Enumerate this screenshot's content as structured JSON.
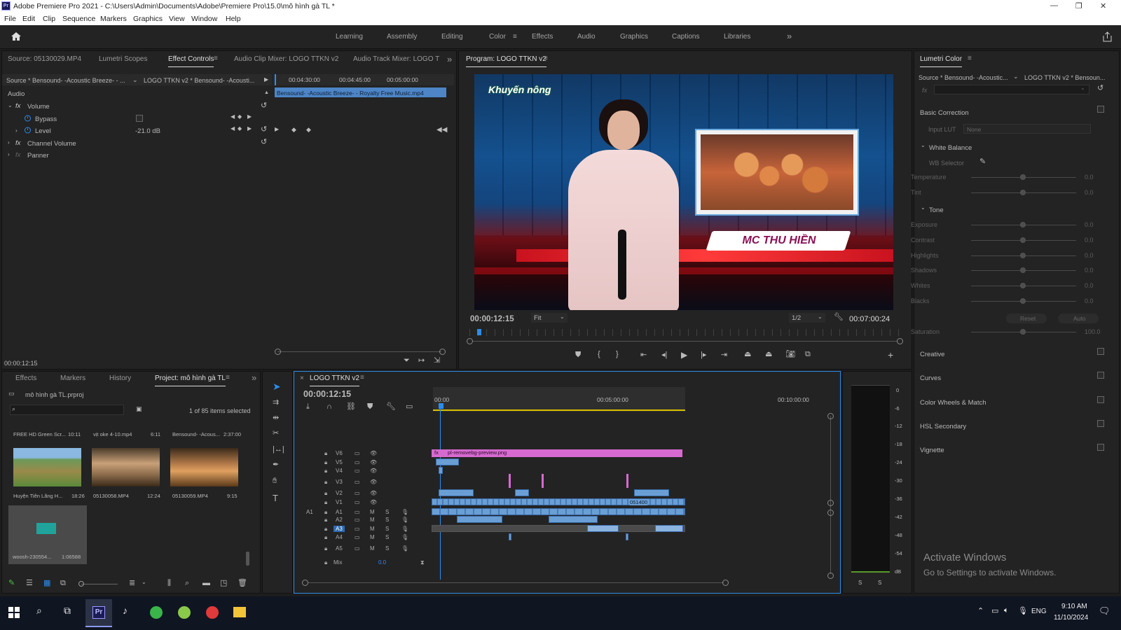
{
  "titlebar": {
    "title": "Adobe Premiere Pro 2021 - C:\\Users\\Admin\\Documents\\Adobe\\Premiere Pro\\15.0\\mô hình gà TL *",
    "app_icon": "Pr"
  },
  "menu": [
    "File",
    "Edit",
    "Clip",
    "Sequence",
    "Markers",
    "Graphics",
    "View",
    "Window",
    "Help"
  ],
  "workspaces": {
    "items": [
      "Learning",
      "Assembly",
      "Editing",
      "Color",
      "Effects",
      "Audio",
      "Graphics",
      "Captions",
      "Libraries"
    ],
    "active": "Color",
    "more": "»"
  },
  "source_panel": {
    "tabs": [
      "Source: 05130029.MP4",
      "Lumetri Scopes",
      "Effect Controls",
      "Audio Clip Mixer: LOGO TTKN v2",
      "Audio Track Mixer: LOGO T"
    ],
    "active_tab": "Effect Controls",
    "source_label": "Source * Bensound- -Acoustic Breeze- - ...",
    "seq_label": "LOGO TTKN v2 * Bensound- -Acousti...",
    "section": "Audio",
    "volume": "Volume",
    "bypass": "Bypass",
    "level": "Level",
    "level_value": "-21.0 dB",
    "channel_volume": "Channel Volume",
    "panner": "Panner",
    "ruler": [
      "00:04:30:00",
      "00:04:45:00",
      "00:05:00:00"
    ],
    "clip_name": "Bensound- -Acoustic Breeze- - Royalty Free Music.mp4",
    "timecode": "00:00:12:15"
  },
  "program": {
    "title": "Program: LOGO TTKN v2",
    "timecode": "00:00:12:15",
    "fit": "Fit",
    "resolution": "1/2",
    "duration": "00:07:00:24",
    "video": {
      "logo_text": "Khuyến nông",
      "name_tag": "MC THU HIỀN"
    }
  },
  "lumetri": {
    "title": "Lumetri Color",
    "source_label": "Source * Bensound- -Acoustic...",
    "seq_label": "LOGO TTKN v2 * Bensoun...",
    "basic_correction": "Basic Correction",
    "input_lut": "Input LUT",
    "input_lut_value": "None",
    "white_balance": "White Balance",
    "wb_selector": "WB Selector",
    "sliders_wb": [
      {
        "name": "Temperature",
        "value": "0.0"
      },
      {
        "name": "Tint",
        "value": "0.0"
      }
    ],
    "tone": "Tone",
    "sliders_tone": [
      {
        "name": "Exposure",
        "value": "0.0"
      },
      {
        "name": "Contrast",
        "value": "0.0"
      },
      {
        "name": "Highlights",
        "value": "0.0"
      },
      {
        "name": "Shadows",
        "value": "0.0"
      },
      {
        "name": "Whites",
        "value": "0.0"
      },
      {
        "name": "Blacks",
        "value": "0.0"
      }
    ],
    "reset": "Reset",
    "auto": "Auto",
    "saturation": {
      "name": "Saturation",
      "value": "100.0"
    },
    "sections": [
      "Creative",
      "Curves",
      "Color Wheels & Match",
      "HSL Secondary",
      "Vignette"
    ]
  },
  "project": {
    "tabs": [
      "Effects",
      "Markers",
      "History",
      "Project: mô hình gà TL"
    ],
    "active_tab": "Project: mô hình gà TL",
    "project_file": "mô hình gà TL.prproj",
    "selected_count": "1 of 85 items selected",
    "items": [
      {
        "name": "FREE HD Green Scr...",
        "duration": "10:11"
      },
      {
        "name": "vịt oke 4-10.mp4",
        "duration": "6:11"
      },
      {
        "name": "Bensound- -Acous...",
        "duration": "2:37:00"
      },
      {
        "name": "Huyện Tiên Lãng H...",
        "duration": "18:26"
      },
      {
        "name": "05130058.MP4",
        "duration": "12:24"
      },
      {
        "name": "05130059.MP4",
        "duration": "9:15"
      },
      {
        "name": "woosh-230554...",
        "duration": "1:06588"
      }
    ]
  },
  "timeline": {
    "title": "LOGO TTKN v2",
    "timecode": "00:00:12:15",
    "ruler": [
      "00:00",
      "00:05:00:00",
      "00:10:00:00"
    ],
    "video_tracks": [
      "V6",
      "V5",
      "V4",
      "V3",
      "V2",
      "V1"
    ],
    "audio_tracks": [
      "A1",
      "A2",
      "A3",
      "A4",
      "A5"
    ],
    "src_patch": "A1",
    "mix": "Mix",
    "mix_value": "0.0",
    "clips": {
      "v6": "pl-removebg-preview.png",
      "v1": "051400"
    },
    "meter_scale": [
      "0",
      "-6",
      "-12",
      "-18",
      "-24",
      "-30",
      "-36",
      "-42",
      "-48",
      "-54",
      "dB"
    ],
    "meter_solo": [
      "S",
      "S"
    ]
  },
  "watermark": {
    "title": "Activate Windows",
    "sub": "Go to Settings to activate Windows."
  },
  "taskbar": {
    "time": "9:10 AM",
    "date": "11/10/2024",
    "lang": "ENG"
  }
}
